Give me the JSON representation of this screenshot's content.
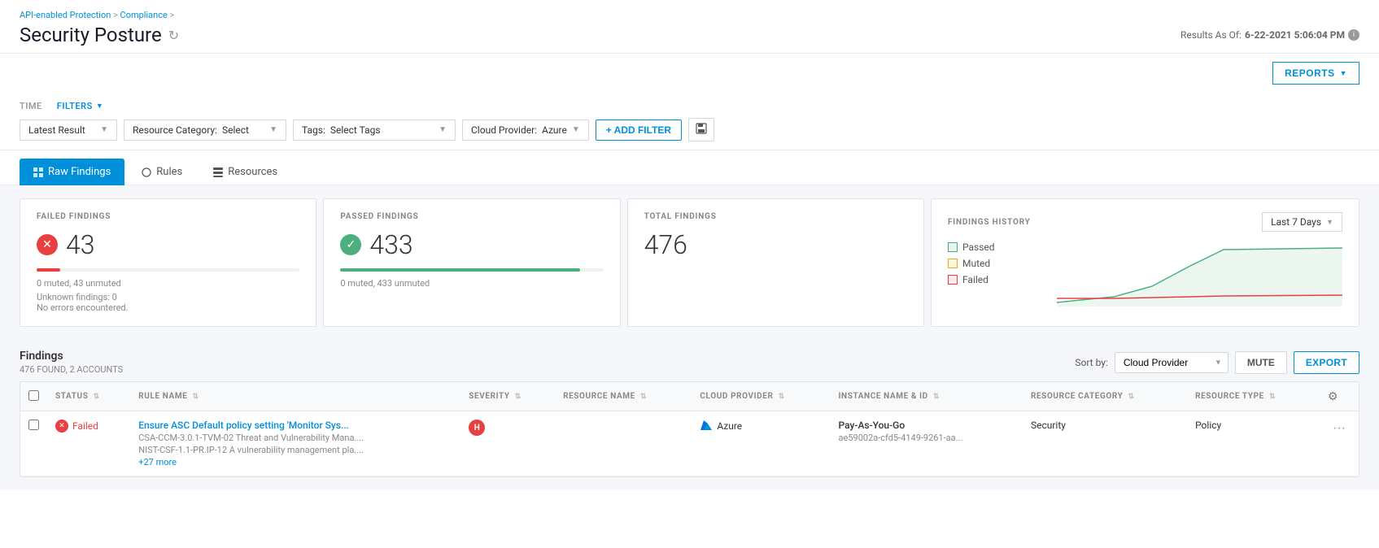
{
  "breadcrumb": {
    "items": [
      "API-enabled Protection",
      "Compliance",
      ""
    ]
  },
  "page": {
    "title": "Security Posture",
    "results_as_of_label": "Results As Of:",
    "results_as_of_value": "6-22-2021 5:06:04 PM"
  },
  "reports_btn": "REPORTS",
  "time": {
    "label": "TIME",
    "value": "Latest Result"
  },
  "filters": {
    "label": "FILTERS",
    "resource_category": {
      "label": "Resource Category:",
      "placeholder": "Select"
    },
    "tags": {
      "label": "Tags:",
      "placeholder": "Select Tags"
    },
    "cloud_provider": {
      "label": "Cloud Provider:",
      "value": "Azure"
    },
    "add_filter_btn": "+ ADD FILTER"
  },
  "tabs": [
    {
      "id": "raw-findings",
      "label": "Raw Findings",
      "active": true
    },
    {
      "id": "rules",
      "label": "Rules",
      "active": false
    },
    {
      "id": "resources",
      "label": "Resources",
      "active": false
    }
  ],
  "metrics": {
    "failed": {
      "label": "FAILED FINDINGS",
      "value": "43",
      "sub1": "0 muted, 43 unmuted",
      "bar_pct": 9,
      "extra1": "Unknown findings: 0",
      "extra2": "No errors encountered."
    },
    "passed": {
      "label": "PASSED FINDINGS",
      "value": "433",
      "sub1": "0 muted, 433 unmuted",
      "bar_pct": 91
    },
    "total": {
      "label": "TOTAL FINDINGS",
      "value": "476"
    }
  },
  "findings_history": {
    "label": "FINDINGS HISTORY",
    "time_range": "Last 7 Days",
    "legend": [
      {
        "id": "passed",
        "label": "Passed",
        "color_class": "legend-box-green"
      },
      {
        "id": "muted",
        "label": "Muted",
        "color_class": "legend-box-orange"
      },
      {
        "id": "failed",
        "label": "Failed",
        "color_class": "legend-box-red"
      }
    ]
  },
  "findings_table": {
    "title": "Findings",
    "subtitle": "476 FOUND, 2 ACCOUNTS",
    "sort_by_label": "Sort by:",
    "sort_by_value": "Cloud Provider",
    "mute_btn": "MUTE",
    "export_btn": "EXPORT",
    "columns": [
      {
        "id": "status",
        "label": "STATUS"
      },
      {
        "id": "rule_name",
        "label": "RULE NAME"
      },
      {
        "id": "severity",
        "label": "SEVERITY"
      },
      {
        "id": "resource_name",
        "label": "RESOURCE NAME"
      },
      {
        "id": "cloud_provider",
        "label": "CLOUD PROVIDER"
      },
      {
        "id": "instance_name",
        "label": "INSTANCE NAME & ID"
      },
      {
        "id": "resource_category",
        "label": "RESOURCE CATEGORY"
      },
      {
        "id": "resource_type",
        "label": "RESOURCE TYPE"
      }
    ],
    "rows": [
      {
        "status": "Failed",
        "rule_name": "Ensure ASC Default policy setting 'Monitor Sys...",
        "rule_sub1": "CSA-CCM-3.0.1-TVM-02 Threat and Vulnerability Mana....",
        "rule_sub2": "NIST-CSF-1.1-PR.IP-12 A vulnerability management pla....",
        "rule_sub3": "+27 more",
        "severity": "H",
        "resource_name": "",
        "cloud_provider": "Azure",
        "instance_name": "Pay-As-You-Go",
        "instance_id": "ae59002a-cfd5-4149-9261-aa...",
        "resource_category": "Security",
        "resource_type": "Policy"
      }
    ]
  }
}
